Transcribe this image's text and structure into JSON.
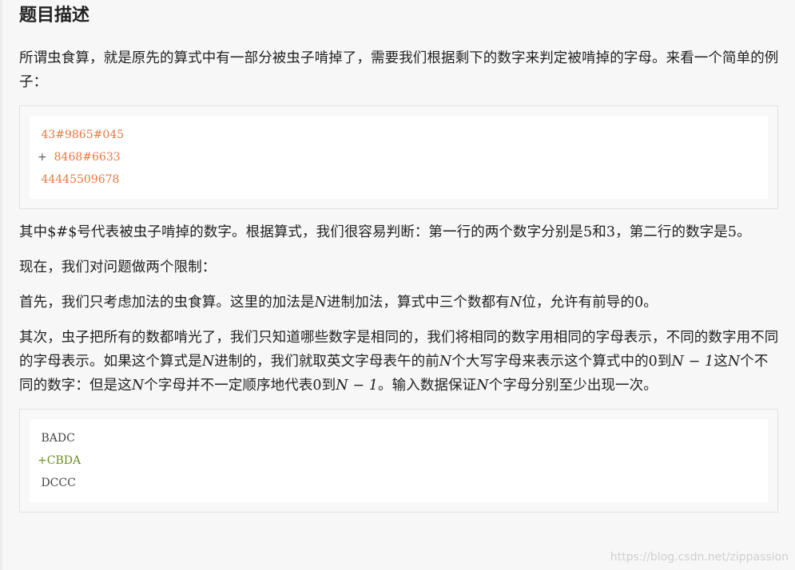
{
  "title": "题目描述",
  "intro": "所谓虫食算，就是原先的算式中有一部分被虫子啃掉了，需要我们根据剩下的数字来判定被啃掉的字母。来看一个简单的例子：",
  "example1": {
    "line1": " 43#9865#045",
    "line2_op": "+  ",
    "line2_val": "8468#6633",
    "line3": " 44445509678"
  },
  "para1": "其中$#$号代表被虫子啃掉的数字。根据算式，我们很容易判断：第一行的两个数字分别是5和3，第二行的数字是5。",
  "para2": "现在，我们对问题做两个限制：",
  "para3": {
    "a": "首先，我们只考虑加法的虫食算。这里的加法是",
    "n": "N",
    "b": "进制加法，算式中三个数都有",
    "n2": "N",
    "c": "位，允许有前导的0。"
  },
  "para4": {
    "a": "其次，虫子把所有的数都啃光了，我们只知道哪些数字是相同的，我们将相同的数字用相同的字母表示，不同的数字用不同的字母表示。如果这个算式是",
    "n1": "N",
    "b": "进制的，我们就取英文字母表午的前",
    "n2": "N",
    "c": "个大写字母来表示这个算式中的0到",
    "n3": "N − 1",
    "d": "这",
    "n4": "N",
    "e": "个不同的数字：但是这",
    "n5": "N",
    "f": "个字母并不一定顺序地代表0到",
    "n6": "N − 1",
    "g": "。输入数据保证",
    "n7": "N",
    "h": "个字母分别至少出现一次。"
  },
  "example2": {
    "line1": " BADC",
    "line2": "+CBDA",
    "line3": " DCCC"
  },
  "watermark": "https://blog.csdn.net/zippassion"
}
